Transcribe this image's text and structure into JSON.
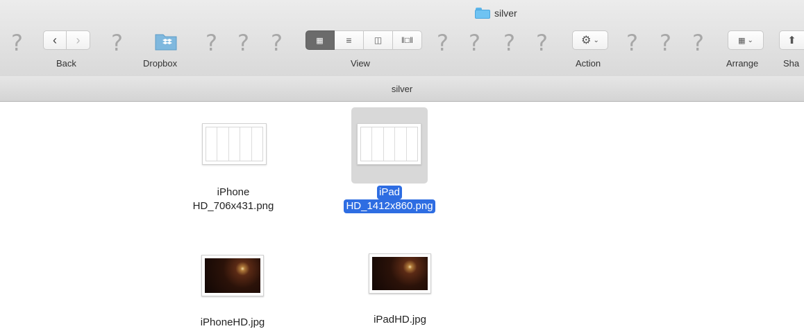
{
  "window": {
    "title": "silver"
  },
  "toolbar": {
    "back_label": "Back",
    "dropbox_label": "Dropbox",
    "view_label": "View",
    "action_label": "Action",
    "arrange_label": "Arrange",
    "share_label": "Sha",
    "placeholder_glyph": "?"
  },
  "pathbar": {
    "text": "silver"
  },
  "files": [
    {
      "line1": "iPhone",
      "line2": "HD_706x431.png",
      "selected": false,
      "kind": "png"
    },
    {
      "line1": "iPad",
      "line2": "HD_1412x860.png",
      "selected": true,
      "kind": "png"
    },
    {
      "line1": "iPhoneHD.jpg",
      "selected": false,
      "kind": "jpg"
    },
    {
      "line1": "iPadHD.jpg",
      "selected": false,
      "kind": "jpg"
    }
  ],
  "colors": {
    "selection": "#2e6de2",
    "folder": "#6fc3f2"
  },
  "icons": [
    "folder-icon",
    "chevron-left-icon",
    "chevron-right-icon",
    "dropbox-icon",
    "icon-view-icon",
    "list-view-icon",
    "column-view-icon",
    "cover-flow-icon",
    "gear-icon",
    "arrange-icon",
    "share-icon",
    "question-icon"
  ]
}
